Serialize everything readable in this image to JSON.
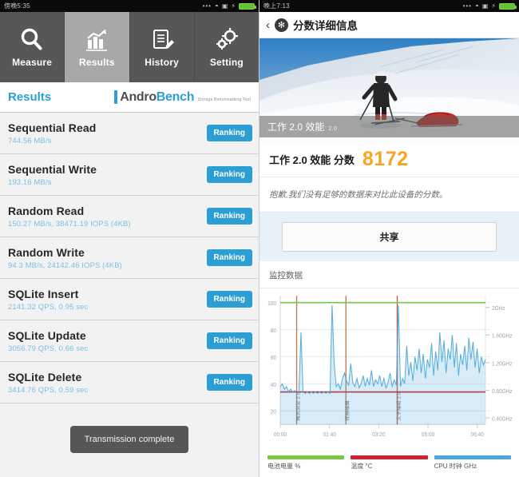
{
  "left": {
    "statusbar": {
      "clock": "傍晚5:35",
      "dots": "•••",
      "wifi_icon": "wifi-icon",
      "sim_icon": "sim-icon",
      "charge_icon": "charging-icon",
      "battery_icon": "battery-icon"
    },
    "tabs": [
      {
        "label": "Measure",
        "icon": "magnifier-icon",
        "active": false
      },
      {
        "label": "Results",
        "icon": "bar-chart-icon",
        "active": true
      },
      {
        "label": "History",
        "icon": "document-icon",
        "active": false
      },
      {
        "label": "Setting",
        "icon": "gears-icon",
        "active": false
      }
    ],
    "header": {
      "title": "Results",
      "brand_main_a": "Andro",
      "brand_main_b": "Bench",
      "brand_sub": "Storage Benchmarking Tool"
    },
    "ranking_label": "Ranking",
    "rows": [
      {
        "name": "Sequential Read",
        "value": "744.56 MB/s"
      },
      {
        "name": "Sequential Write",
        "value": "193.16 MB/s"
      },
      {
        "name": "Random Read",
        "value": "150.27 MB/s, 38471.19 IOPS (4KB)"
      },
      {
        "name": "Random Write",
        "value": "94.3 MB/s, 24142.46 IOPS (4KB)"
      },
      {
        "name": "SQLite Insert",
        "value": "2141.32 QPS, 0.95 sec"
      },
      {
        "name": "SQLite Update",
        "value": "3056.79 QPS, 0.66 sec"
      },
      {
        "name": "SQLite Delete",
        "value": "3414.76 QPS, 0.59 sec"
      }
    ],
    "toast": "Transmission complete"
  },
  "right": {
    "statusbar": {
      "clock": "晚上7:13",
      "dots": "•••"
    },
    "header": {
      "back": "‹",
      "logo": "✻",
      "title": "分数详细信息"
    },
    "banner": {
      "caption": "工作 2.0 效能",
      "version": "2.0",
      "alt": "skier-pulling-sled-photo"
    },
    "score": {
      "label": "工作 2.0 效能 分数",
      "value": "8172"
    },
    "note": "抱歉,我们没有足够的数据来对比此设备的分数。",
    "share_label": "共享",
    "monitor_label": "监控数据",
    "legend": [
      {
        "text": "电池电量 %",
        "color": "#7ac943"
      },
      {
        "text": "温度 °C",
        "color": "#d0212f"
      },
      {
        "text": "CPU 时钟 GHz",
        "color": "#4aa8d8"
      }
    ]
  },
  "chart_data": {
    "type": "line",
    "title": "监控数据",
    "xlabel": "",
    "ylabel": "",
    "grid": true,
    "legend_position": "bottom",
    "x_ticks": [
      "00:00",
      "01:40",
      "03:20",
      "05:00",
      "06:40"
    ],
    "y_left_ticks": [
      20,
      40,
      60,
      80,
      100
    ],
    "ylim": [
      10,
      105
    ],
    "y_right_ticks": [
      "0.40GHz",
      "0.80GHz",
      "1.20GHz",
      "1.60GHz",
      "2GHz"
    ],
    "y_right_lim": [
      0.2,
      2.1
    ],
    "markers": [
      {
        "x_pct": 8,
        "color": "#b0693f",
        "label": "网页浏览 2.0"
      },
      {
        "x_pct": 32,
        "color": "#b0693f",
        "label": "视频编辑"
      },
      {
        "x_pct": 57,
        "color": "#c0392b",
        "label": "文字编辑 2.0"
      }
    ],
    "series": [
      {
        "name": "电池电量 %",
        "color": "#7ac943",
        "axis": "left",
        "values": [
          100,
          100,
          100,
          100,
          100,
          100,
          100,
          100,
          100,
          100,
          100,
          100,
          100,
          100,
          100,
          100,
          100,
          100,
          100,
          100,
          100,
          100,
          100,
          100,
          100,
          100,
          100,
          100,
          100,
          100,
          100,
          100,
          100,
          100,
          100,
          100,
          100,
          100,
          100,
          100,
          100,
          100,
          100,
          100,
          100,
          100,
          100,
          100,
          100,
          100,
          100,
          100,
          100,
          100,
          100,
          100,
          100,
          100,
          100,
          100,
          100,
          100,
          100,
          100,
          100,
          100,
          100,
          100,
          100,
          100,
          100,
          100,
          100,
          100,
          100,
          100,
          100,
          100,
          100,
          100,
          100,
          100,
          100,
          100,
          100,
          100,
          100,
          100,
          100,
          100,
          100,
          100,
          100,
          100,
          100,
          100,
          100,
          100,
          100,
          100
        ]
      },
      {
        "name": "温度 °C",
        "color": "#d0212f",
        "axis": "left",
        "values": [
          34,
          34,
          34,
          34,
          34,
          34,
          34,
          34,
          34,
          34,
          34,
          34,
          34,
          34,
          34,
          34,
          34,
          34,
          34,
          34,
          34,
          34,
          34,
          34,
          34,
          34,
          34,
          34,
          34,
          34,
          34,
          34,
          34,
          34,
          34,
          34,
          34,
          34,
          34,
          34,
          34,
          34,
          34,
          34,
          34,
          34,
          34,
          34,
          34,
          34,
          34,
          34,
          34,
          34,
          34,
          34,
          34,
          34,
          34,
          34,
          34,
          34,
          34,
          34,
          34,
          34,
          34,
          34,
          34,
          34,
          34,
          34,
          34,
          34,
          34,
          34,
          34,
          34,
          34,
          34,
          34,
          34,
          34,
          34,
          34,
          34,
          34,
          34,
          34,
          34,
          34,
          34,
          34,
          34,
          34,
          34,
          34,
          34,
          34,
          34
        ]
      },
      {
        "name": "CPU 时钟 GHz",
        "color": "#4aa8d8",
        "axis": "right",
        "values": [
          38,
          40,
          36,
          38,
          34,
          36,
          34,
          35,
          33,
          34,
          78,
          34,
          33,
          34,
          33,
          34,
          33,
          34,
          33,
          34,
          33,
          34,
          33,
          34,
          33,
          98,
          55,
          38,
          40,
          36,
          44,
          48,
          42,
          39,
          55,
          41,
          38,
          44,
          37,
          40,
          46,
          38,
          44,
          39,
          50,
          38,
          43,
          40,
          46,
          38,
          44,
          37,
          41,
          48,
          38,
          43,
          39,
          98,
          38,
          44,
          40,
          68,
          46,
          56,
          42,
          60,
          50,
          66,
          48,
          62,
          44,
          58,
          52,
          70,
          46,
          64,
          50,
          78,
          56,
          72,
          48,
          66,
          58,
          76,
          52,
          70,
          46,
          62,
          54,
          68,
          50,
          74,
          58,
          71,
          52,
          66,
          48,
          60,
          54,
          58
        ]
      }
    ]
  }
}
